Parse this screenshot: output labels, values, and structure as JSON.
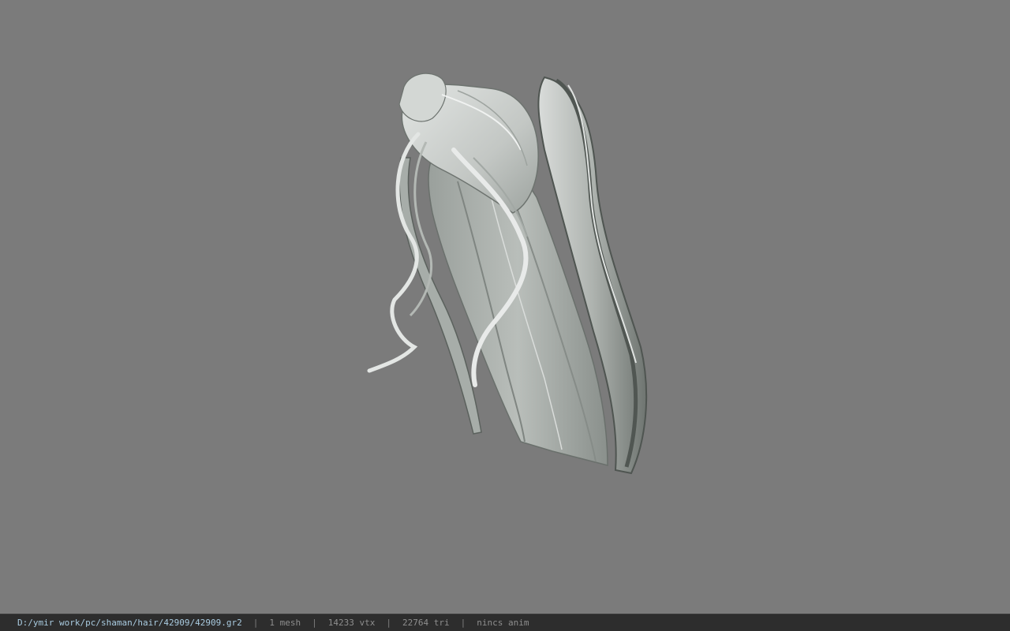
{
  "viewport": {
    "background_color": "#7b7b7b",
    "model_color": "#c4c8c5",
    "model_shadow_color": "#4d524f"
  },
  "statusbar": {
    "file_path": "D:/ymir work/pc/shaman/hair/42909/42909.gr2",
    "separator": "|",
    "mesh_count": "1 mesh",
    "vertex_count": "14233 vtx",
    "triangle_count": "22764 tri",
    "anim_status": "nincs anim"
  }
}
